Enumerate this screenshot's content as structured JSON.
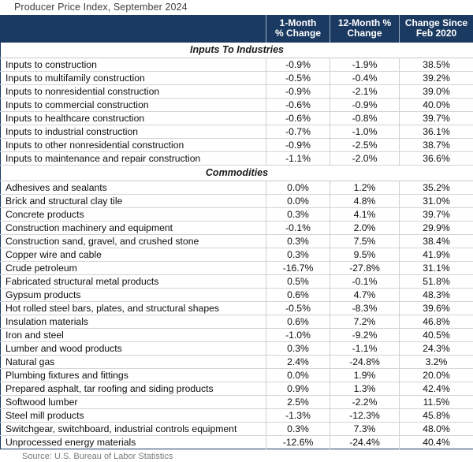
{
  "title": "Producer Price Index, September 2024",
  "source": "Source: U.S. Bureau of Labor Statistics",
  "header": {
    "label_col": "",
    "col_1month": "1-Month\n% Change",
    "col_1month_line1": "1-Month",
    "col_1month_line2": "% Change",
    "col_12month_line1": "12-Month %",
    "col_12month_line2": "Change",
    "col_since_line1": "Change Since",
    "col_since_line2": "Feb 2020"
  },
  "colors": {
    "header_bg": "#1b3a62",
    "header_text": "#ffffff",
    "title_text": "#404040",
    "source_text": "#7a7a7a",
    "row_divider": "#d4d4d4",
    "table_border": "#1b3a62"
  },
  "sections": [
    {
      "name": "Inputs To Industries",
      "rows": [
        {
          "label": "Inputs to construction",
          "m1": "-0.9%",
          "m12": "-1.9%",
          "since": "38.5%"
        },
        {
          "label": "Inputs to multifamily construction",
          "m1": "-0.5%",
          "m12": "-0.4%",
          "since": "39.2%"
        },
        {
          "label": "Inputs to nonresidential construction",
          "m1": "-0.9%",
          "m12": "-2.1%",
          "since": "39.0%"
        },
        {
          "label": "Inputs to commercial construction",
          "m1": "-0.6%",
          "m12": "-0.9%",
          "since": "40.0%"
        },
        {
          "label": "Inputs to healthcare construction",
          "m1": "-0.6%",
          "m12": "-0.8%",
          "since": "39.7%"
        },
        {
          "label": "Inputs to industrial construction",
          "m1": "-0.7%",
          "m12": "-1.0%",
          "since": "36.1%"
        },
        {
          "label": "Inputs to other nonresidential construction",
          "m1": "-0.9%",
          "m12": "-2.5%",
          "since": "38.7%"
        },
        {
          "label": "Inputs to maintenance and repair construction",
          "m1": "-1.1%",
          "m12": "-2.0%",
          "since": "36.6%"
        }
      ]
    },
    {
      "name": "Commodities",
      "rows": [
        {
          "label": "Adhesives and sealants",
          "m1": "0.0%",
          "m12": "1.2%",
          "since": "35.2%"
        },
        {
          "label": "Brick and structural clay tile",
          "m1": "0.0%",
          "m12": "4.8%",
          "since": "31.0%"
        },
        {
          "label": "Concrete products",
          "m1": "0.3%",
          "m12": "4.1%",
          "since": "39.7%"
        },
        {
          "label": "Construction machinery and equipment",
          "m1": "-0.1%",
          "m12": "2.0%",
          "since": "29.9%"
        },
        {
          "label": "Construction sand, gravel, and crushed stone",
          "m1": "0.3%",
          "m12": "7.5%",
          "since": "38.4%"
        },
        {
          "label": "Copper wire and cable",
          "m1": "0.3%",
          "m12": "9.5%",
          "since": "41.9%"
        },
        {
          "label": "Crude petroleum",
          "m1": "-16.7%",
          "m12": "-27.8%",
          "since": "31.1%"
        },
        {
          "label": "Fabricated structural metal products",
          "m1": "0.5%",
          "m12": "-0.1%",
          "since": "51.8%"
        },
        {
          "label": "Gypsum products",
          "m1": "0.6%",
          "m12": "4.7%",
          "since": "48.3%"
        },
        {
          "label": "Hot rolled steel bars, plates, and structural shapes",
          "m1": "-0.5%",
          "m12": "-8.3%",
          "since": "39.6%"
        },
        {
          "label": "Insulation materials",
          "m1": "0.6%",
          "m12": "7.2%",
          "since": "46.8%"
        },
        {
          "label": "Iron and steel",
          "m1": "-1.0%",
          "m12": "-9.2%",
          "since": "40.5%"
        },
        {
          "label": "Lumber and wood products",
          "m1": "0.3%",
          "m12": "-1.1%",
          "since": "24.3%"
        },
        {
          "label": "Natural gas",
          "m1": "2.4%",
          "m12": "-24.8%",
          "since": "3.2%"
        },
        {
          "label": "Plumbing fixtures and fittings",
          "m1": "0.0%",
          "m12": "1.9%",
          "since": "20.0%"
        },
        {
          "label": "Prepared asphalt, tar roofing and siding products",
          "m1": "0.9%",
          "m12": "1.3%",
          "since": "42.4%"
        },
        {
          "label": "Softwood lumber",
          "m1": "2.5%",
          "m12": "-2.2%",
          "since": "11.5%"
        },
        {
          "label": "Steel mill products",
          "m1": "-1.3%",
          "m12": "-12.3%",
          "since": "45.8%"
        },
        {
          "label": "Switchgear, switchboard, industrial controls equipment",
          "m1": "0.3%",
          "m12": "7.3%",
          "since": "48.0%"
        },
        {
          "label": "Unprocessed energy materials",
          "m1": "-12.6%",
          "m12": "-24.4%",
          "since": "40.4%"
        }
      ]
    }
  ]
}
